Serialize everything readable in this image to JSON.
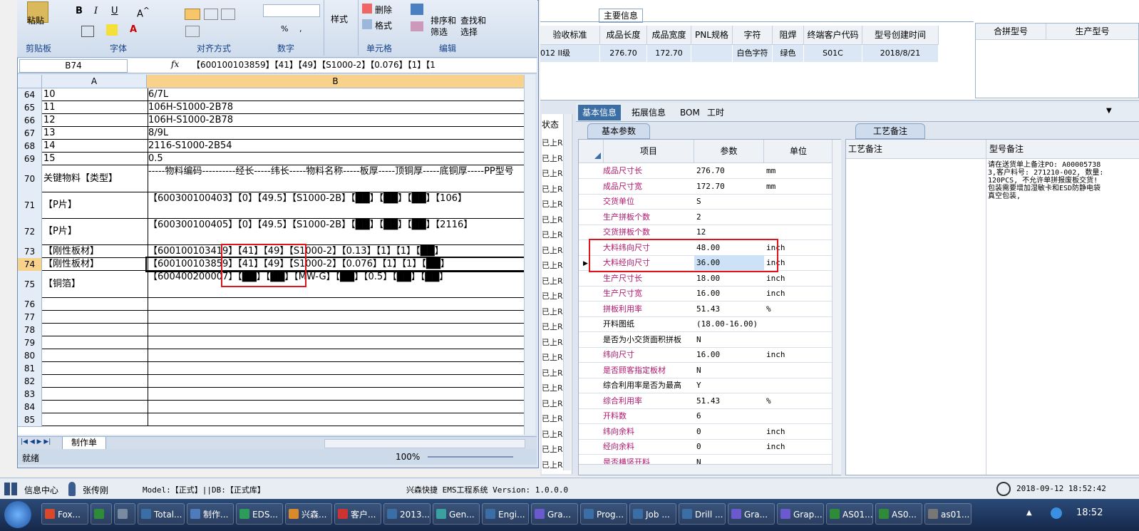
{
  "main_info": {
    "tab_label": "主要信息",
    "columns": [
      "验收标准",
      "成品长度",
      "成品宽度",
      "PNL规格",
      "字符",
      "阻焊",
      "终端客户代码",
      "型号创建时间"
    ],
    "row": [
      "012 II级",
      "276.70",
      "172.70",
      "",
      "白色字符",
      "绿色",
      "S01C",
      "2018/8/21"
    ],
    "right_columns": [
      "合拼型号",
      "生产型号"
    ]
  },
  "left_status": {
    "header": "状态",
    "item_label": "已上R"
  },
  "detail_tabs": [
    "基本信息",
    "拓展信息",
    "BOM",
    "工时"
  ],
  "basic_params": {
    "panel_title": "基本参数",
    "columns": [
      "项目",
      "参数",
      "单位"
    ],
    "rows": [
      {
        "name": "成品尺寸长",
        "value": "276.70",
        "unit": "mm",
        "pink": true
      },
      {
        "name": "成品尺寸宽",
        "value": "172.70",
        "unit": "mm",
        "pink": true
      },
      {
        "name": "交货单位",
        "value": "S",
        "unit": "",
        "pink": true
      },
      {
        "name": "生产拼板个数",
        "value": "2",
        "unit": "",
        "pink": true
      },
      {
        "name": "交货拼板个数",
        "value": "12",
        "unit": "",
        "pink": true
      },
      {
        "name": "大料纬向尺寸",
        "value": "48.00",
        "unit": "inch",
        "pink": true
      },
      {
        "name": "大料经向尺寸",
        "value": "36.00",
        "unit": "inch",
        "pink": true
      },
      {
        "name": "生产尺寸长",
        "value": "18.00",
        "unit": "inch",
        "pink": true
      },
      {
        "name": "生产尺寸宽",
        "value": "16.00",
        "unit": "inch",
        "pink": true
      },
      {
        "name": "拼板利用率",
        "value": "51.43",
        "unit": "%",
        "pink": true
      },
      {
        "name": "开料图纸",
        "value": "(18.00-16.00)",
        "unit": "",
        "pink": false
      },
      {
        "name": "是否为小交货面积拼板",
        "value": "N",
        "unit": "",
        "pink": false
      },
      {
        "name": "纬向尺寸",
        "value": "16.00",
        "unit": "inch",
        "pink": true
      },
      {
        "name": "是否顾客指定板材",
        "value": "N",
        "unit": "",
        "pink": true
      },
      {
        "name": "综合利用率是否为最高",
        "value": "Y",
        "unit": "",
        "pink": false
      },
      {
        "name": "综合利用率",
        "value": "51.43",
        "unit": "%",
        "pink": true
      },
      {
        "name": "开料数",
        "value": "6",
        "unit": "",
        "pink": true
      },
      {
        "name": "纬向余料",
        "value": "0",
        "unit": "inch",
        "pink": true
      },
      {
        "name": "经向余料",
        "value": "0",
        "unit": "inch",
        "pink": true
      },
      {
        "name": "是否横竖开料",
        "value": "N",
        "unit": "",
        "pink": true
      }
    ]
  },
  "craft_notes": {
    "tab_label": "工艺备注",
    "col1": "工艺备注",
    "col2": "型号备注",
    "note": "请在送货单上备注PO: A000057383,客户料号: 271210-002, 数量: 120PCS, 不允许单拼报废板交货! 包装需要增加湿敏卡和ESD防静电袋真空包装,"
  },
  "excel": {
    "ribbon": {
      "paste": "粘贴",
      "clipboard": "剪贴板",
      "font": "字体",
      "align": "对齐方式",
      "number": "数字",
      "style": "样式",
      "cells": "单元格",
      "edit": "编辑",
      "delete": "删除",
      "format": "格式",
      "sort": "排序和",
      "filter": "筛选",
      "find": "查找和",
      "select": "选择"
    },
    "name_box": "B74",
    "fx": "fx",
    "formula": "【600100103859】【41】【49】【S1000-2】【0.076】【1】【1",
    "col_a": "A",
    "col_b": "B",
    "rows": [
      {
        "n": "64",
        "a": "10",
        "b": "6/7L",
        "h": 18
      },
      {
        "n": "65",
        "a": "11",
        "b": "106H-S1000-2B78",
        "h": 18
      },
      {
        "n": "66",
        "a": "12",
        "b": "106H-S1000-2B78",
        "h": 18
      },
      {
        "n": "67",
        "a": "13",
        "b": "8/9L",
        "h": 18
      },
      {
        "n": "68",
        "a": "14",
        "b": "2116-S1000-2B54",
        "h": 18
      },
      {
        "n": "69",
        "a": "15",
        "b": "0.5",
        "h": 18
      },
      {
        "n": "70",
        "a": "关键物料【类型】",
        "b": "-----物料编码----------经长-----纬长-----物料名称-----板厚-----顶铜厚-----底铜厚-----PP型号",
        "h": 38
      },
      {
        "n": "71",
        "a": "【P片】",
        "b": "【600300100403】【0】【49.5】【S1000-2B】【██】【██】【██】【106】",
        "h": 37
      },
      {
        "n": "72",
        "a": "【P片】",
        "b": "【600300100405】【0】【49.5】【S1000-2B】【██】【██】【██】【2116】",
        "h": 37
      },
      {
        "n": "73",
        "a": "【刚性板材】",
        "b": "【600100103419】【41】【49】【S1000-2】【0.13】【1】【1】【██】",
        "h": 18
      },
      {
        "n": "74",
        "a": "【刚性板材】",
        "b": "【600100103859】【41】【49】【S1000-2】【0.076】【1】【1】【██】",
        "h": 18
      },
      {
        "n": "75",
        "a": "【铜箔】",
        "b": "【600400200007】【██】【██】【MW-G】【██】【0.5】【██】【██】",
        "h": 38
      },
      {
        "n": "76",
        "a": "",
        "b": "",
        "h": 18
      },
      {
        "n": "77",
        "a": "",
        "b": "",
        "h": 18
      },
      {
        "n": "78",
        "a": "",
        "b": "",
        "h": 18
      },
      {
        "n": "79",
        "a": "",
        "b": "",
        "h": 18
      },
      {
        "n": "80",
        "a": "",
        "b": "",
        "h": 18
      },
      {
        "n": "81",
        "a": "",
        "b": "",
        "h": 18
      },
      {
        "n": "82",
        "a": "",
        "b": "",
        "h": 18
      },
      {
        "n": "83",
        "a": "",
        "b": "",
        "h": 18
      },
      {
        "n": "84",
        "a": "",
        "b": "",
        "h": 18
      },
      {
        "n": "85",
        "a": "",
        "b": "",
        "h": 18
      }
    ],
    "sheet_tab": "制作单",
    "status": "就绪",
    "zoom": "100%"
  },
  "app_status": {
    "info_center": "信息中心",
    "user": "张传刚",
    "model": "Model:【正式】||DB:【正式库】",
    "system": "兴森快捷 EMS工程系统 Version: 1.0.0.0",
    "datetime": "2018-09-12 18:52:42"
  },
  "taskbar": {
    "items": [
      "Fox...",
      "",
      "",
      "Total...",
      "制作...",
      "EDS...",
      "兴森...",
      "客户...",
      "2013...",
      "Gen...",
      "Engi...",
      "Gra...",
      "Prog...",
      "Job ...",
      "Drill ...",
      "Gra...",
      "Grap...",
      "AS01...",
      "AS0...",
      "as01..."
    ],
    "clock": "18:52"
  },
  "colors": {
    "accent": "#3a6ea5",
    "highlight": "#dbe7f5",
    "pink": "#b0176d",
    "red_box": "#e0151b"
  }
}
